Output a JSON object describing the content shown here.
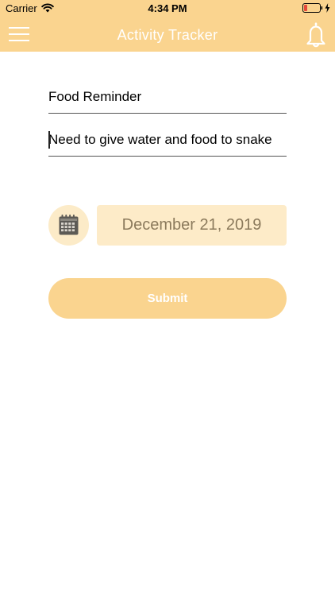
{
  "status_bar": {
    "carrier": "Carrier",
    "time": "4:34 PM",
    "battery_color": "#e64a3c"
  },
  "nav": {
    "title": "Activity Tracker",
    "background": "#fad48f"
  },
  "form": {
    "title_value": "Food Reminder",
    "description_value": "Need to give water and food to snake",
    "date": "December 21, 2019",
    "submit_label": "Submit"
  }
}
